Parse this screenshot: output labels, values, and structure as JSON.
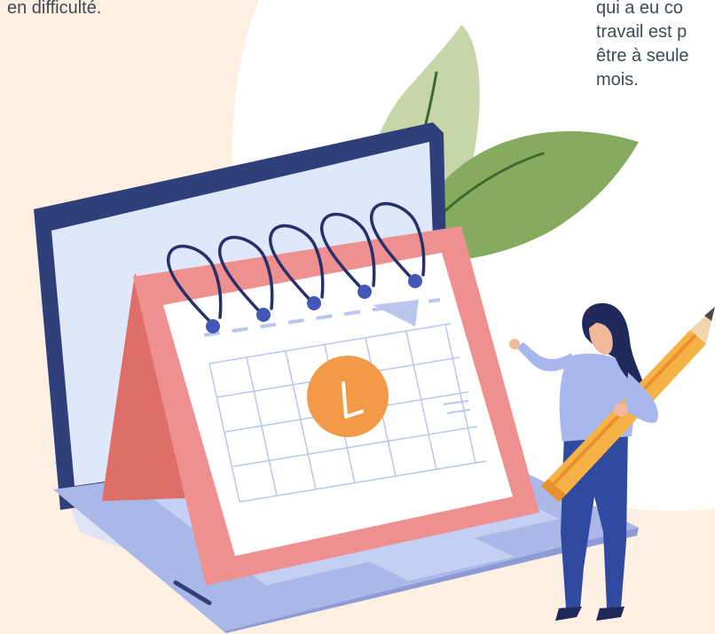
{
  "left_text": {
    "line1": "en difficulté."
  },
  "right_text": {
    "line1": "qui a eu co",
    "line2": "travail est p",
    "line3": "être à seule",
    "line4": "mois."
  },
  "colors": {
    "background": "#fdf0e2",
    "blob": "#ffffff",
    "laptop_frame": "#2f3f7a",
    "laptop_screen": "#dfe7fb",
    "laptop_base": "#aab8e8",
    "calendar_body": "#ef9090",
    "calendar_side": "#dd6e68",
    "calendar_page": "#ffffff",
    "grid_lines": "#b9c6ee",
    "check_circle": "#f39a48",
    "leaf_light": "#c6d6a8",
    "leaf_dark": "#86aa5e",
    "pencil": "#f7b245",
    "person_shirt": "#a8b8ef",
    "person_pants": "#2f4aa0",
    "person_hair": "#1f2a5a"
  },
  "icons": [
    "calendar-icon",
    "check-icon",
    "pencil-icon"
  ]
}
